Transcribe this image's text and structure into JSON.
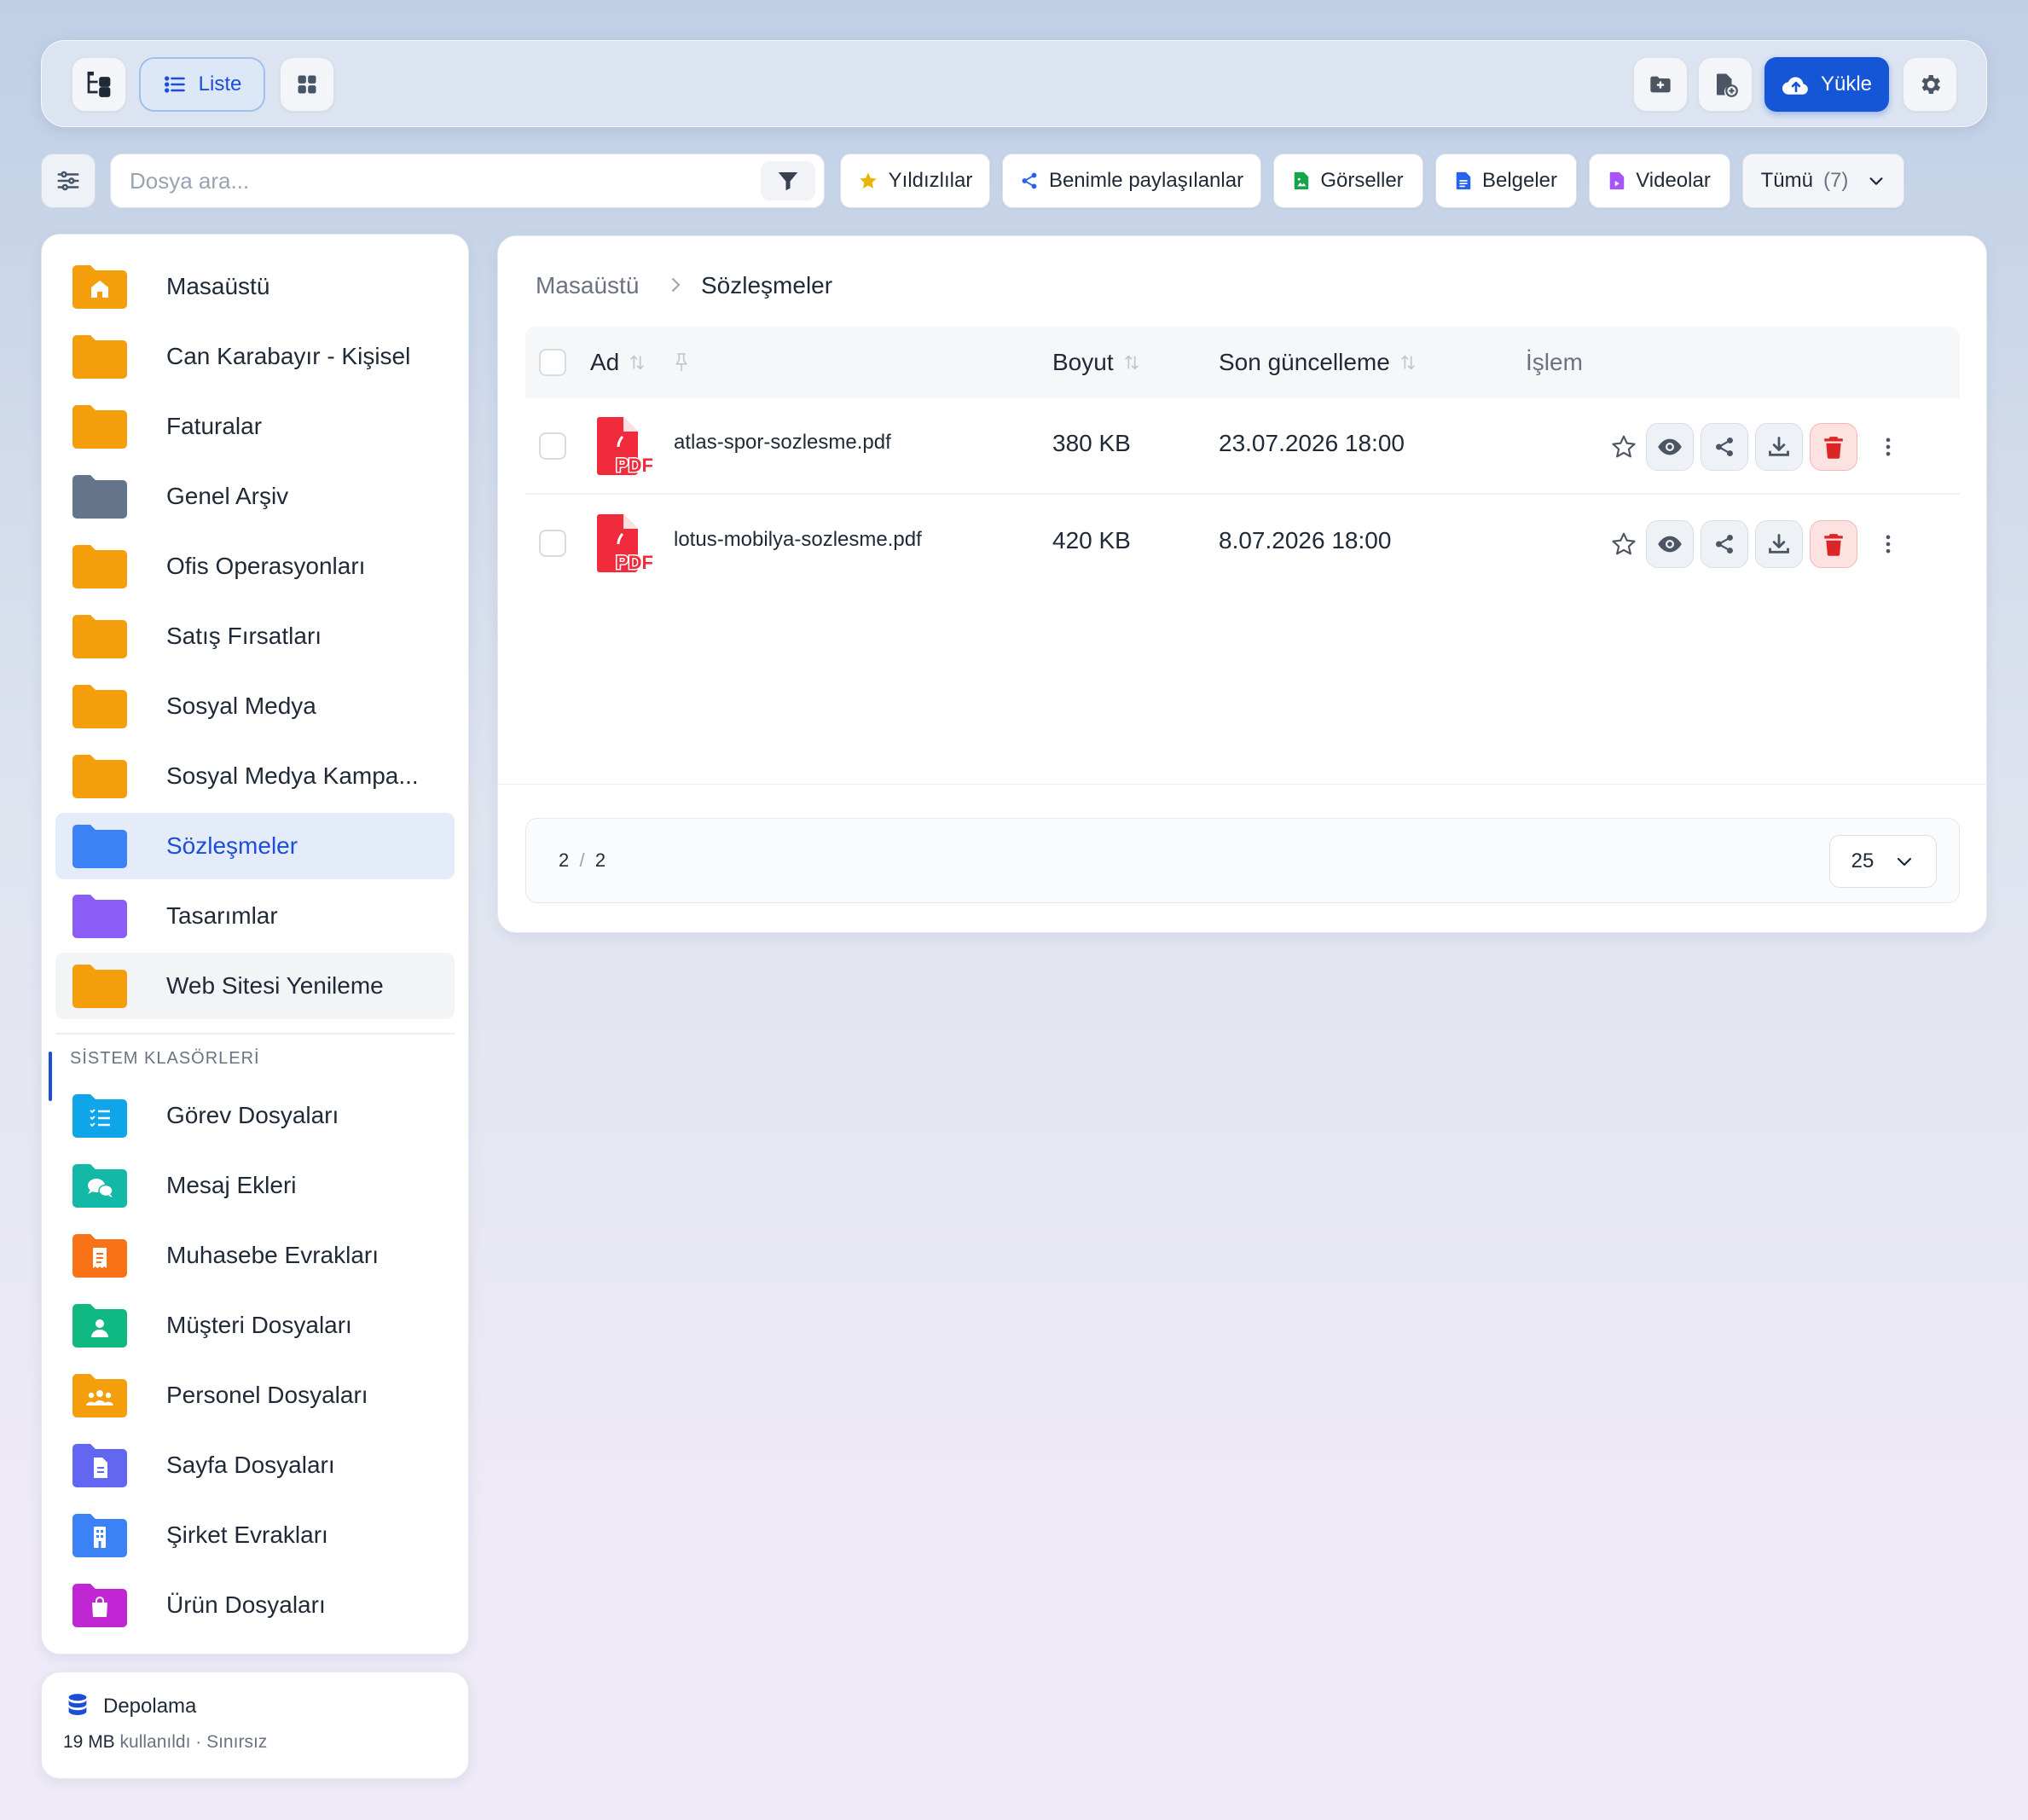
{
  "toolbar": {
    "view_list_label": "Liste",
    "upload_label": "Yükle"
  },
  "search": {
    "placeholder": "Dosya ara..."
  },
  "filters": [
    {
      "label": "Yıldızlılar",
      "icon": "star-icon",
      "color": "#eab308"
    },
    {
      "label": "Benimle paylaşılanlar",
      "icon": "share-icon",
      "color": "#2563eb"
    },
    {
      "label": "Görseller",
      "icon": "image-file-icon",
      "color": "#16a34a"
    },
    {
      "label": "Belgeler",
      "icon": "document-icon",
      "color": "#2563eb"
    },
    {
      "label": "Videolar",
      "icon": "video-file-icon",
      "color": "#a855f7"
    }
  ],
  "type_select": {
    "label": "Tümü",
    "count": "(7)"
  },
  "sidebar": {
    "folders": [
      {
        "label": "Masaüstü",
        "color": "#f59e0b",
        "icon": "home-folder-icon"
      },
      {
        "label": "Can Karabayır - Kişisel",
        "color": "#f59e0b",
        "icon": "folder-icon"
      },
      {
        "label": "Faturalar",
        "color": "#f59e0b",
        "icon": "folder-icon"
      },
      {
        "label": "Genel Arşiv",
        "color": "#64748b",
        "icon": "folder-icon"
      },
      {
        "label": "Ofis Operasyonları",
        "color": "#f59e0b",
        "icon": "folder-icon"
      },
      {
        "label": "Satış Fırsatları",
        "color": "#f59e0b",
        "icon": "folder-icon"
      },
      {
        "label": "Sosyal Medya",
        "color": "#f59e0b",
        "icon": "folder-icon"
      },
      {
        "label": "Sosyal Medya Kampa...",
        "color": "#f59e0b",
        "icon": "folder-icon"
      },
      {
        "label": "Sözleşmeler",
        "color": "#3b82f6",
        "icon": "folder-icon"
      },
      {
        "label": "Tasarımlar",
        "color": "#8b5cf6",
        "icon": "folder-icon"
      },
      {
        "label": "Web Sitesi Yenileme",
        "color": "#f59e0b",
        "icon": "folder-icon"
      }
    ],
    "system_section_title": "SİSTEM KLASÖRLERİ",
    "system_folders": [
      {
        "label": "Görev Dosyaları",
        "color": "#0ea5e9",
        "icon": "task-list-folder-icon"
      },
      {
        "label": "Mesaj Ekleri",
        "color": "#14b8a6",
        "icon": "chat-folder-icon"
      },
      {
        "label": "Muhasebe Evrakları",
        "color": "#f97316",
        "icon": "receipt-folder-icon"
      },
      {
        "label": "Müşteri Dosyaları",
        "color": "#10b981",
        "icon": "contact-folder-icon"
      },
      {
        "label": "Personel Dosyaları",
        "color": "#f59e0b",
        "icon": "people-folder-icon"
      },
      {
        "label": "Sayfa Dosyaları",
        "color": "#6366f1",
        "icon": "page-folder-icon"
      },
      {
        "label": "Şirket Evrakları",
        "color": "#3b82f6",
        "icon": "building-folder-icon"
      },
      {
        "label": "Ürün Dosyaları",
        "color": "#c026d3",
        "icon": "bag-folder-icon"
      }
    ]
  },
  "storage": {
    "title": "Depolama",
    "used": "19 MB",
    "used_suffix": "kullanıldı · Sınırsız"
  },
  "breadcrumb": {
    "root": "Masaüstü",
    "current": "Sözleşmeler"
  },
  "table": {
    "columns": {
      "name": "Ad",
      "size": "Boyut",
      "updated": "Son güncelleme",
      "actions": "İşlem"
    },
    "rows": [
      {
        "name": "atlas-spor-sozlesme.pdf",
        "size": "380 KB",
        "updated": "23.07.2026 18:00",
        "icon": "pdf-file-icon"
      },
      {
        "name": "lotus-mobilya-sozlesme.pdf",
        "size": "420 KB",
        "updated": "8.07.2026 18:00",
        "icon": "pdf-file-icon"
      }
    ]
  },
  "pagination": {
    "shown": "2",
    "total": "2",
    "page_size": "25"
  },
  "colors": {
    "accent": "#1d4ed8",
    "upload_button": "#1456d6",
    "delete": "#dc2626",
    "pdf": "#ef2b3c"
  }
}
